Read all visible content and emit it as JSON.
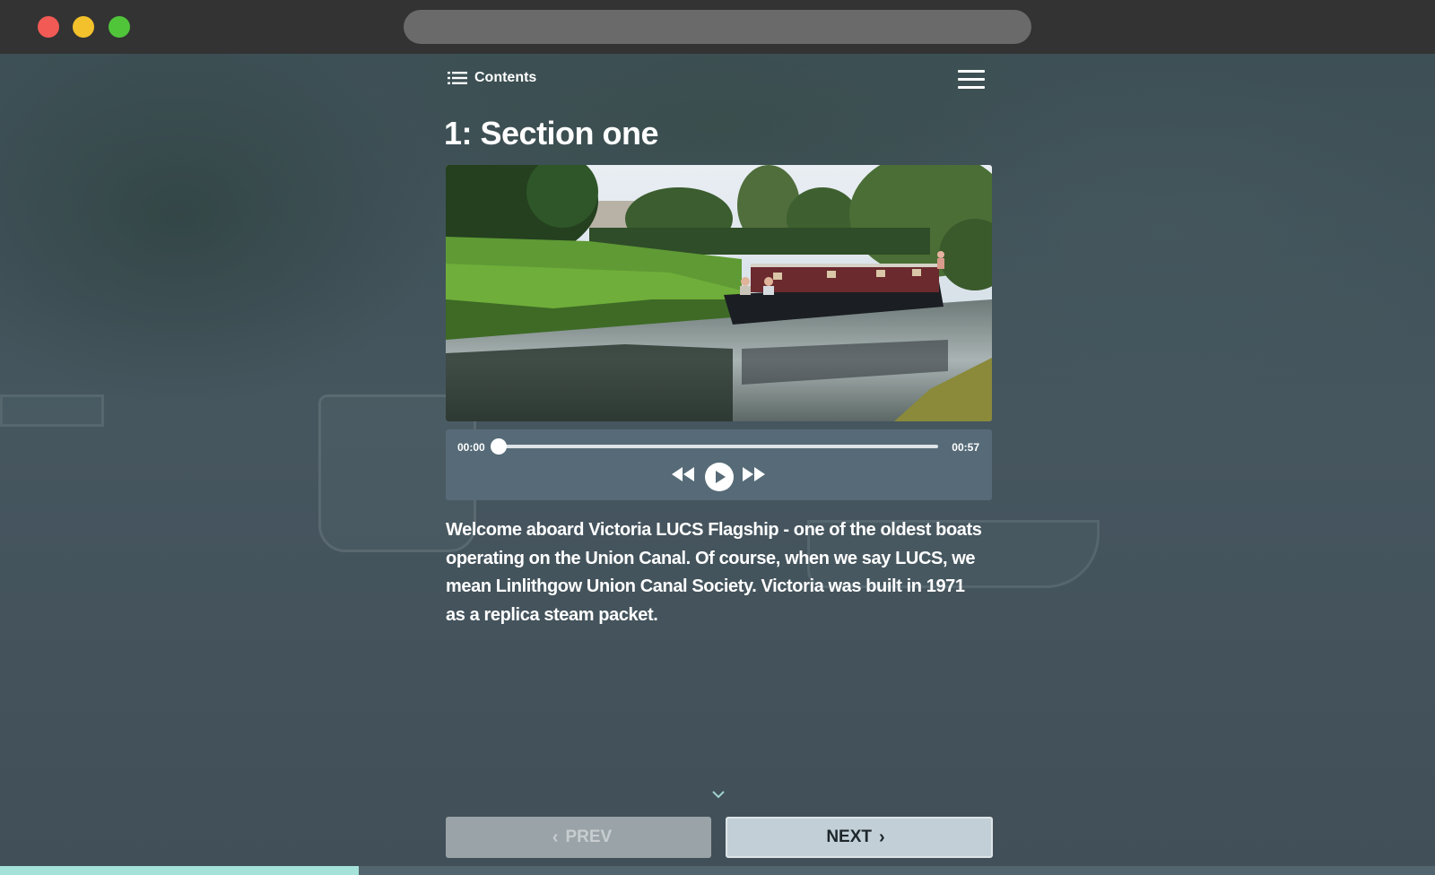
{
  "window": {
    "traffic_lights": [
      "close",
      "minimize",
      "maximize"
    ],
    "colors": {
      "close": "#f25a55",
      "minimize": "#f3c12b",
      "maximize": "#50c53a"
    }
  },
  "header": {
    "contents_label": "Contents",
    "contents_icon": "list-icon",
    "menu_icon": "hamburger-menu-icon"
  },
  "section": {
    "title": "1: Section one"
  },
  "player": {
    "current_time": "00:00",
    "duration": "00:57",
    "progress": 0.0,
    "controls": [
      "rewind-icon",
      "play-icon",
      "fast-forward-icon"
    ]
  },
  "description": "Welcome aboard Victoria LUCS Flagship - one of the oldest boats operating on the Union Canal. Of course, when we say LUCS, we mean Linlithgow Union Canal Society. Victoria was built in 1971 as a replica steam packet.",
  "navigation": {
    "prev_label": "PREV",
    "next_label": "NEXT",
    "scroll_hint_icon": "chevron-down-icon"
  },
  "page_progress": 0.25,
  "colors": {
    "accent": "#a4e2da",
    "player_bg": "#566b77",
    "next_button": "#c2cfd6",
    "prev_button": "#9aa3a7"
  }
}
